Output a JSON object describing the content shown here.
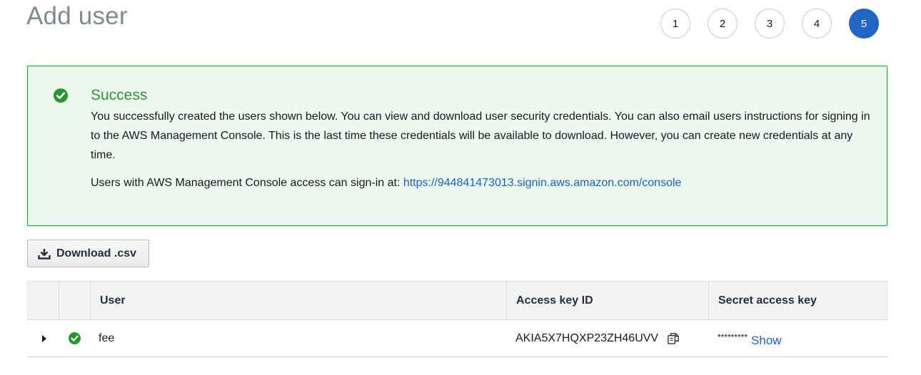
{
  "page": {
    "title": "Add user"
  },
  "steps": [
    "1",
    "2",
    "3",
    "4",
    "5"
  ],
  "active_step": "5",
  "alert": {
    "title": "Success",
    "body": "You successfully created the users shown below. You can view and download user security credentials. You can also email users instructions for signing in to the AWS Management Console. This is the last time these credentials will be available to download. However, you can create new credentials at any time.",
    "signin_prefix": "Users with AWS Management Console access can sign-in at: ",
    "signin_url": "https://944841473013.signin.aws.amazon.com/console",
    "icon": "check-circle-icon",
    "color": "#2a9630"
  },
  "toolbar": {
    "download_label": "Download .csv",
    "download_icon": "download-icon"
  },
  "table": {
    "columns": [
      "",
      "",
      "User",
      "Access key ID",
      "Secret access key"
    ],
    "rows": [
      {
        "status_icon": "check-circle-icon",
        "user": "fee",
        "access_key_id": "AKIA5X7HQXP23ZH46UVV",
        "secret_masked": "*********",
        "show_label": "Show"
      }
    ]
  },
  "colors": {
    "accent": "#2165c5",
    "link": "#1a5fc8",
    "success_bg": "#edf8ef",
    "success_border": "#2c9b3f"
  }
}
